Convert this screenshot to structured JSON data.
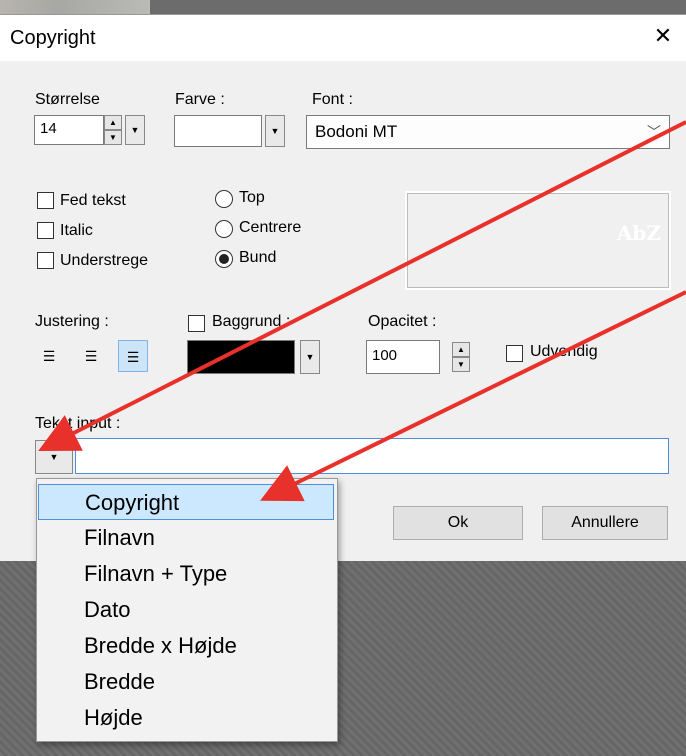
{
  "window": {
    "title": "Copyright",
    "close_glyph": "✕"
  },
  "size": {
    "label": "Størrelse",
    "value": "14"
  },
  "color": {
    "label": "Farve :"
  },
  "font": {
    "label": "Font :",
    "value": "Bodoni MT"
  },
  "style_checks": [
    {
      "label": "Fed tekst",
      "checked": false
    },
    {
      "label": "Italic",
      "checked": false
    },
    {
      "label": "Understrege",
      "checked": false
    }
  ],
  "position_radios": [
    {
      "label": "Top",
      "selected": false
    },
    {
      "label": "Centrere",
      "selected": false
    },
    {
      "label": "Bund",
      "selected": true
    }
  ],
  "preview": {
    "text": "AbZ"
  },
  "alignment": {
    "label": "Justering :",
    "active": "right"
  },
  "background": {
    "label": "Baggrund :",
    "checked": false,
    "color": "#000000"
  },
  "opacity": {
    "label": "Opacitet :",
    "value": "100"
  },
  "outside": {
    "label": "Udvendig",
    "checked": false
  },
  "text_input": {
    "label": "Tekst input :",
    "value": ""
  },
  "buttons": {
    "ok": "Ok",
    "cancel": "Annullere"
  },
  "dropdown": {
    "items": [
      "Copyright",
      "Filnavn",
      "Filnavn + Type",
      "Dato",
      "Bredde x Højde",
      "Bredde",
      "Højde"
    ],
    "selected_index": 0
  },
  "colors": {
    "arrow": "#e8312a",
    "selection_bg": "#cce8ff",
    "selection_border": "#4d90d9"
  }
}
